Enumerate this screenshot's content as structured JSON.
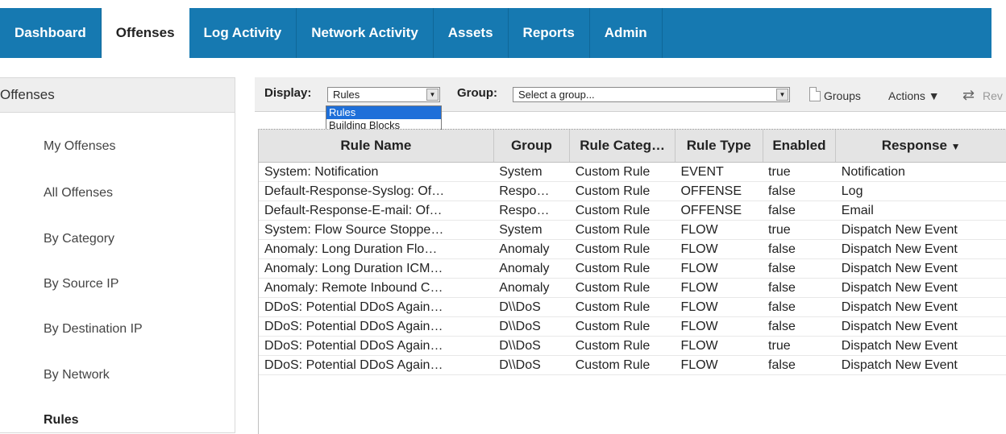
{
  "nav": {
    "tabs": [
      "Dashboard",
      "Offenses",
      "Log Activity",
      "Network Activity",
      "Assets",
      "Reports",
      "Admin"
    ],
    "active": "Offenses"
  },
  "sidebar": {
    "title": "Offenses",
    "items": [
      "My Offenses",
      "All Offenses",
      "By Category",
      "By Source IP",
      "By Destination IP",
      "By Network",
      "Rules"
    ]
  },
  "toolbar": {
    "display_label": "Display:",
    "display_value": "Rules",
    "display_options": [
      "Rules",
      "Building Blocks"
    ],
    "group_label": "Group:",
    "group_placeholder": "Select a group...",
    "groups_label": "Groups",
    "actions_label": "Actions ▼",
    "rev_label": "Rev"
  },
  "table": {
    "columns": [
      "Rule Name",
      "Group",
      "Rule Categ…",
      "Rule Type",
      "Enabled",
      "Response"
    ],
    "rows": [
      [
        "System: Notification",
        "System",
        "Custom Rule",
        "EVENT",
        "true",
        "Notification"
      ],
      [
        "Default-Response-Syslog: Of…",
        "Respo…",
        "Custom Rule",
        "OFFENSE",
        "false",
        "Log"
      ],
      [
        "Default-Response-E-mail: Of…",
        "Respo…",
        "Custom Rule",
        "OFFENSE",
        "false",
        "Email"
      ],
      [
        "System: Flow Source Stoppe…",
        "System",
        "Custom Rule",
        "FLOW",
        "true",
        "Dispatch New Event"
      ],
      [
        "Anomaly: Long Duration Flo…",
        "Anomaly",
        "Custom Rule",
        "FLOW",
        "false",
        "Dispatch New Event"
      ],
      [
        "Anomaly: Long Duration ICM…",
        "Anomaly",
        "Custom Rule",
        "FLOW",
        "false",
        "Dispatch New Event"
      ],
      [
        "Anomaly: Remote Inbound C…",
        "Anomaly",
        "Custom Rule",
        "FLOW",
        "false",
        "Dispatch New Event"
      ],
      [
        "DDoS: Potential DDoS Again…",
        "D\\\\DoS",
        "Custom Rule",
        "FLOW",
        "false",
        "Dispatch New Event"
      ],
      [
        "DDoS: Potential DDoS Again…",
        "D\\\\DoS",
        "Custom Rule",
        "FLOW",
        "false",
        "Dispatch New Event"
      ],
      [
        "DDoS: Potential DDoS Again…",
        "D\\\\DoS",
        "Custom Rule",
        "FLOW",
        "true",
        "Dispatch New Event"
      ],
      [
        "DDoS: Potential DDoS Again…",
        "D\\\\DoS",
        "Custom Rule",
        "FLOW",
        "false",
        "Dispatch New Event"
      ]
    ]
  },
  "colors": {
    "nav_blue": "#1679b1",
    "select_highlight": "#1e6fd9"
  }
}
